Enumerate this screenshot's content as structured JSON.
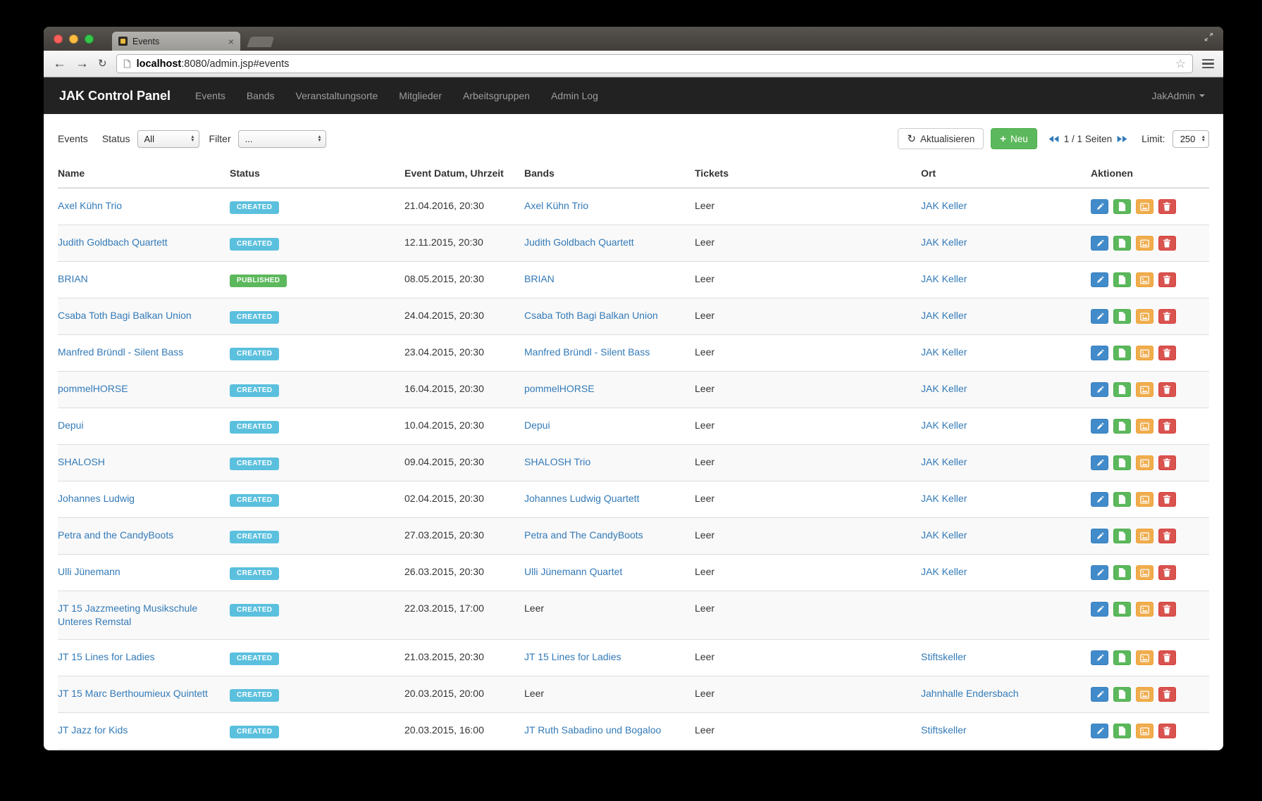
{
  "chrome": {
    "tab_title": "Events",
    "url_host": "localhost",
    "url_path": ":8080/admin.jsp#events"
  },
  "navbar": {
    "brand": "JAK Control Panel",
    "items": [
      "Events",
      "Bands",
      "Veranstaltungsorte",
      "Mitglieder",
      "Arbeitsgruppen",
      "Admin Log"
    ],
    "user_menu": "JakAdmin"
  },
  "toolbar": {
    "title": "Events",
    "status_label": "Status",
    "status_value": "All",
    "filter_label": "Filter",
    "filter_value": "...",
    "refresh_button": "Aktualisieren",
    "new_button": "Neu",
    "pages_text": "1 / 1 Seiten",
    "limit_label": "Limit:",
    "limit_value": "250"
  },
  "table": {
    "headers": [
      "Name",
      "Status",
      "Event Datum, Uhrzeit",
      "Bands",
      "Tickets",
      "Ort",
      "Aktionen"
    ],
    "rows": [
      {
        "name": "Axel Kühn Trio",
        "status": "CREATED",
        "datetime": "21.04.2016, 20:30",
        "bands": "Axel Kühn Trio",
        "bands_link": true,
        "tickets": "Leer",
        "ort": "JAK Keller"
      },
      {
        "name": "Judith Goldbach Quartett",
        "status": "CREATED",
        "datetime": "12.11.2015, 20:30",
        "bands": "Judith Goldbach Quartett",
        "bands_link": true,
        "tickets": "Leer",
        "ort": "JAK Keller"
      },
      {
        "name": "BRIAN",
        "status": "PUBLISHED",
        "datetime": "08.05.2015, 20:30",
        "bands": "BRIAN",
        "bands_link": true,
        "tickets": "Leer",
        "ort": "JAK Keller"
      },
      {
        "name": "Csaba Toth Bagi Balkan Union",
        "status": "CREATED",
        "datetime": "24.04.2015, 20:30",
        "bands": "Csaba Toth Bagi Balkan Union",
        "bands_link": true,
        "tickets": "Leer",
        "ort": "JAK Keller"
      },
      {
        "name": "Manfred Bründl - Silent Bass",
        "status": "CREATED",
        "datetime": "23.04.2015, 20:30",
        "bands": "Manfred Bründl - Silent Bass",
        "bands_link": true,
        "tickets": "Leer",
        "ort": "JAK Keller"
      },
      {
        "name": "pommelHORSE",
        "status": "CREATED",
        "datetime": "16.04.2015, 20:30",
        "bands": "pommelHORSE",
        "bands_link": true,
        "tickets": "Leer",
        "ort": "JAK Keller"
      },
      {
        "name": "Depui",
        "status": "CREATED",
        "datetime": "10.04.2015, 20:30",
        "bands": "Depui",
        "bands_link": true,
        "tickets": "Leer",
        "ort": "JAK Keller"
      },
      {
        "name": "SHALOSH",
        "status": "CREATED",
        "datetime": "09.04.2015, 20:30",
        "bands": "SHALOSH Trio",
        "bands_link": true,
        "tickets": "Leer",
        "ort": "JAK Keller"
      },
      {
        "name": "Johannes Ludwig",
        "status": "CREATED",
        "datetime": "02.04.2015, 20:30",
        "bands": "Johannes Ludwig Quartett",
        "bands_link": true,
        "tickets": "Leer",
        "ort": "JAK Keller"
      },
      {
        "name": "Petra and the CandyBoots",
        "status": "CREATED",
        "datetime": "27.03.2015, 20:30",
        "bands": "Petra and The CandyBoots",
        "bands_link": true,
        "tickets": "Leer",
        "ort": "JAK Keller"
      },
      {
        "name": "Ulli Jünemann",
        "status": "CREATED",
        "datetime": "26.03.2015, 20:30",
        "bands": "Ulli Jünemann Quartet",
        "bands_link": true,
        "tickets": "Leer",
        "ort": "JAK Keller"
      },
      {
        "name": "JT 15 Jazzmeeting Musikschule Unteres Remstal",
        "status": "CREATED",
        "datetime": "22.03.2015, 17:00",
        "bands": "Leer",
        "bands_link": false,
        "tickets": "Leer",
        "ort": ""
      },
      {
        "name": "JT 15 Lines for Ladies",
        "status": "CREATED",
        "datetime": "21.03.2015, 20:30",
        "bands": "JT 15 Lines for Ladies",
        "bands_link": true,
        "tickets": "Leer",
        "ort": "Stiftskeller"
      },
      {
        "name": "JT 15 Marc Berthoumieux Quintett",
        "status": "CREATED",
        "datetime": "20.03.2015, 20:00",
        "bands": "Leer",
        "bands_link": false,
        "tickets": "Leer",
        "ort": "Jahnhalle Endersbach"
      },
      {
        "name": "JT Jazz for Kids",
        "status": "CREATED",
        "datetime": "20.03.2015, 16:00",
        "bands": "JT Ruth Sabadino und Bogaloo",
        "bands_link": true,
        "tickets": "Leer",
        "ort": "Stiftskeller"
      }
    ]
  },
  "icons": {
    "refresh": "↻",
    "plus": "+",
    "star": "☆",
    "back": "←",
    "forward": "→",
    "tab_close": "×"
  },
  "colors": {
    "status": {
      "CREATED": "#5bc0de",
      "PUBLISHED": "#5cb85c"
    },
    "link": "#337ab7",
    "new_button": "#5cb85c",
    "action_edit": "#428bca",
    "action_file": "#5cb85c",
    "action_image": "#f0ad4e",
    "action_delete": "#d9534f",
    "navbar_bg": "#222222"
  }
}
